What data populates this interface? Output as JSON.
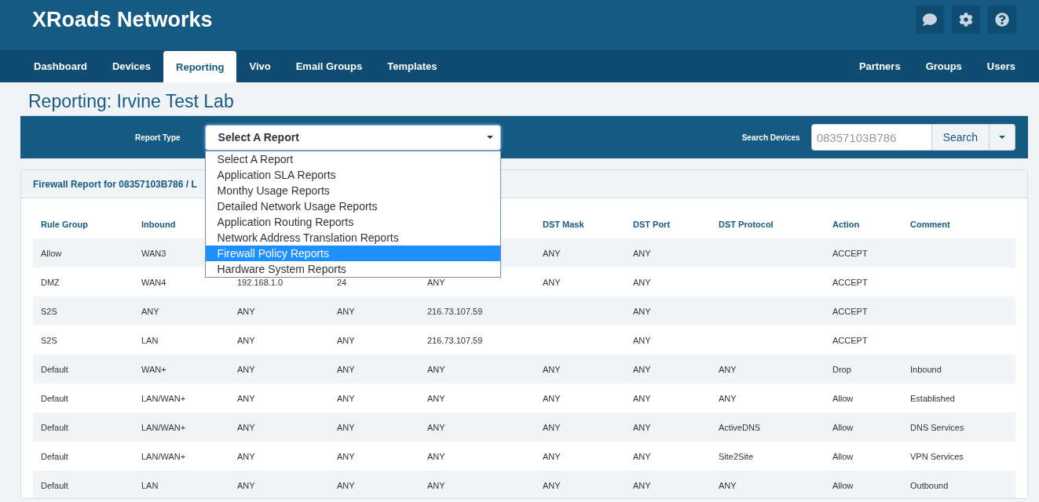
{
  "brand": "XRoads Networks",
  "nav": {
    "left": [
      {
        "label": "Dashboard",
        "selected": false
      },
      {
        "label": "Devices",
        "selected": false
      },
      {
        "label": "Reporting",
        "selected": true
      },
      {
        "label": "Vivo",
        "selected": false
      },
      {
        "label": "Email Groups",
        "selected": false
      },
      {
        "label": "Templates",
        "selected": false
      }
    ],
    "right": [
      {
        "label": "Partners",
        "selected": false
      },
      {
        "label": "Groups",
        "selected": false
      },
      {
        "label": "Users",
        "selected": false
      }
    ]
  },
  "page_title": "Reporting: Irvine Test Lab",
  "toolbar": {
    "report_type": {
      "label": "Report Type",
      "value": "Select A Report",
      "expanded": true,
      "options": [
        {
          "label": "Select A Report",
          "highlighted": false
        },
        {
          "label": "Application SLA Reports",
          "highlighted": false
        },
        {
          "label": "Monthy Usage Reports",
          "highlighted": false
        },
        {
          "label": "Detailed Network Usage Reports",
          "highlighted": false
        },
        {
          "label": "Application Routing Reports",
          "highlighted": false
        },
        {
          "label": "Network Address Translation Reports",
          "highlighted": false
        },
        {
          "label": "Firewall Policy Reports",
          "highlighted": true
        },
        {
          "label": "Hardware System Reports",
          "highlighted": false
        }
      ]
    },
    "search": {
      "label": "Search Devices",
      "placeholder": "08357103B786",
      "button": "Search"
    }
  },
  "report": {
    "title": "Firewall Report for 08357103B786 / L",
    "columns": [
      "Rule Group",
      "Inbound",
      null,
      null,
      null,
      "DST Mask",
      "DST Port",
      "DST Protocol",
      "Action",
      "Comment"
    ],
    "rows": [
      [
        "Allow",
        "WAN3",
        null,
        null,
        null,
        "ANY",
        "ANY",
        null,
        "ACCEPT",
        null
      ],
      [
        "DMZ",
        "WAN4",
        "192.168.1.0",
        "24",
        "ANY",
        "ANY",
        "ANY",
        null,
        "ACCEPT",
        null
      ],
      [
        "S2S",
        "ANY",
        "ANY",
        "ANY",
        "216.73.107.59",
        null,
        "ANY",
        null,
        "ACCEPT",
        null
      ],
      [
        "S2S",
        "LAN",
        "ANY",
        "ANY",
        "216.73.107.59",
        null,
        "ANY",
        null,
        "ACCEPT",
        null
      ],
      [
        "Default",
        "WAN+",
        "ANY",
        "ANY",
        "ANY",
        "ANY",
        "ANY",
        "ANY",
        "Drop",
        "Inbound"
      ],
      [
        "Default",
        "LAN/WAN+",
        "ANY",
        "ANY",
        "ANY",
        "ANY",
        "ANY",
        "ANY",
        "Allow",
        "Established"
      ],
      [
        "Default",
        "LAN/WAN+",
        "ANY",
        "ANY",
        "ANY",
        "ANY",
        "ANY",
        "ActiveDNS",
        "Allow",
        "DNS Services"
      ],
      [
        "Default",
        "LAN/WAN+",
        "ANY",
        "ANY",
        "ANY",
        "ANY",
        "ANY",
        "Site2Site",
        "Allow",
        "VPN Services"
      ],
      [
        "Default",
        "LAN",
        "ANY",
        "ANY",
        "ANY",
        "ANY",
        "ANY",
        "ANY",
        "Allow",
        "Outbound"
      ]
    ]
  }
}
